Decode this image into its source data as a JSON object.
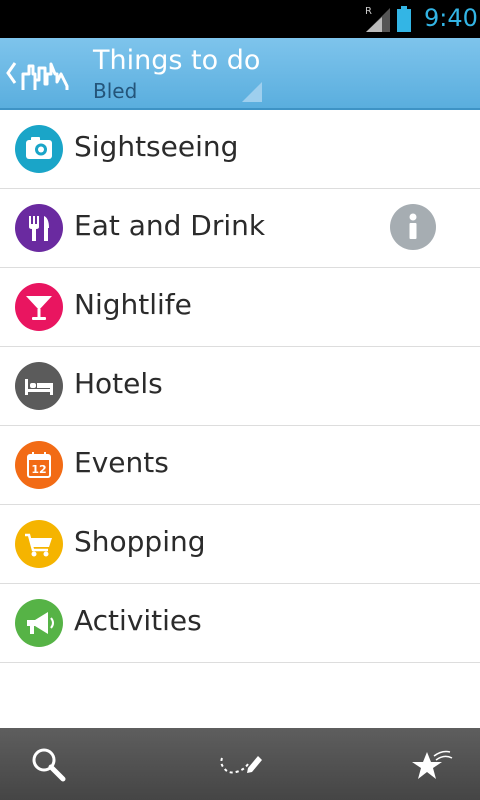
{
  "status_bar": {
    "time": "9:40",
    "roaming_label": "R",
    "signal_icon": "signal-icon",
    "battery_icon": "battery-icon"
  },
  "action_bar": {
    "title": "Things to do",
    "subtitle": "Bled",
    "back_icon": "chevron-left-icon",
    "logo_icon": "skyline-logo-icon"
  },
  "categories": [
    {
      "label": "Sightseeing",
      "icon": "camera-icon",
      "color": "#1aa5c8"
    },
    {
      "label": "Eat and Drink",
      "icon": "fork-knife-icon",
      "color": "#6a2aa0"
    },
    {
      "label": "Nightlife",
      "icon": "cocktail-icon",
      "color": "#e91560"
    },
    {
      "label": "Hotels",
      "icon": "bed-icon",
      "color": "#5b5b5b"
    },
    {
      "label": "Events",
      "icon": "calendar-icon",
      "color": "#f26b15",
      "calendar_day": "12"
    },
    {
      "label": "Shopping",
      "icon": "cart-icon",
      "color": "#f5b400"
    },
    {
      "label": "Activities",
      "icon": "megaphone-icon",
      "color": "#56b346"
    }
  ],
  "bottom_bar": {
    "items": [
      "search-icon",
      "route-pencil-icon",
      "favorites-stars-icon"
    ]
  },
  "colors": {
    "status_time": "#33b5e5",
    "action_bar": "#6ab8e4",
    "info_icon": "#a6adb2",
    "bottom_bar": "#505050"
  }
}
